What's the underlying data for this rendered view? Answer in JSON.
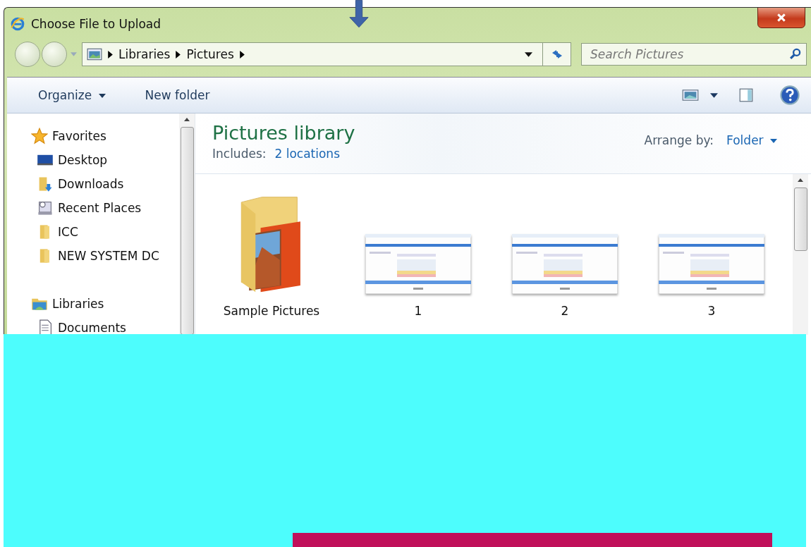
{
  "window": {
    "title": "Choose File to Upload"
  },
  "address": {
    "crumbs": [
      "Libraries",
      "Pictures"
    ]
  },
  "search": {
    "placeholder": "Search Pictures"
  },
  "toolbar": {
    "organize": "Organize",
    "new_folder": "New folder"
  },
  "sidebar": {
    "groups": [
      {
        "label": "Favorites",
        "kind": "star",
        "items": [
          {
            "label": "Desktop",
            "kind": "desktop"
          },
          {
            "label": "Downloads",
            "kind": "downloads"
          },
          {
            "label": "Recent Places",
            "kind": "recent"
          },
          {
            "label": "ICC",
            "kind": "folder"
          },
          {
            "label": "NEW SYSTEM DC",
            "kind": "folder"
          }
        ]
      },
      {
        "label": "Libraries",
        "kind": "library",
        "items": [
          {
            "label": "Documents",
            "kind": "document"
          }
        ]
      }
    ]
  },
  "library": {
    "title": "Pictures library",
    "includes_label": "Includes:",
    "includes_link": "2 locations",
    "arrange_label": "Arrange by:",
    "arrange_value": "Folder"
  },
  "items": [
    {
      "label": "Sample Pictures",
      "kind": "folder"
    },
    {
      "label": "1",
      "kind": "picture"
    },
    {
      "label": "2",
      "kind": "picture"
    },
    {
      "label": "3",
      "kind": "picture"
    }
  ]
}
